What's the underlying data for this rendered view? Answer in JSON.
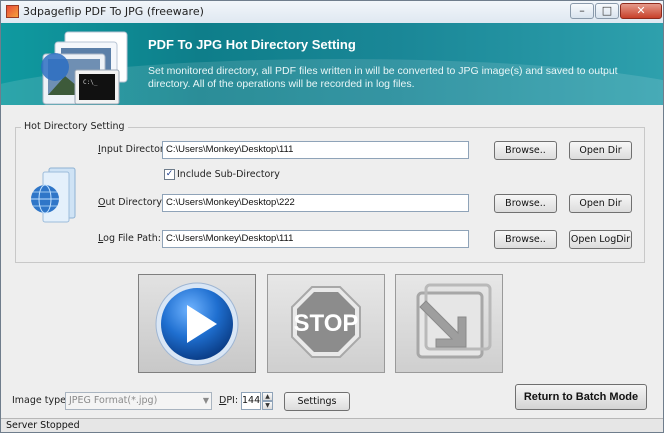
{
  "window": {
    "title": "3dpageflip PDF To JPG (freeware)",
    "minimize_glyph": "–",
    "maximize_glyph": "□",
    "close_glyph": "✕"
  },
  "banner": {
    "title": "PDF To JPG Hot Directory Setting",
    "description": "Set monitored directory, all PDF files written in will be converted to JPG image(s) and saved to output directory. All of the operations will be recorded in log files."
  },
  "settings": {
    "group_title": "Hot Directory Setting",
    "input_dir": {
      "label_key": "I",
      "label_rest": "nput Directory:",
      "value": "C:\\Users\\Monkey\\Desktop\\111",
      "browse": "Browse..",
      "open": "Open Dir"
    },
    "include_sub": {
      "checked_glyph": "✓",
      "label": "Include Sub-Directory",
      "checked": true
    },
    "out_dir": {
      "label_key": "O",
      "label_rest": "ut Directory:",
      "value": "C:\\Users\\Monkey\\Desktop\\222",
      "browse": "Browse..",
      "open": "Open Dir"
    },
    "log_path": {
      "label_key": "L",
      "label_rest": "og File Path:",
      "value": "C:\\Users\\Monkey\\Desktop\\111",
      "browse": "Browse..",
      "open": "Open LogDir"
    }
  },
  "actions": {
    "stop_label": "STOP"
  },
  "bottom": {
    "image_type_label": "Image type:",
    "image_type_value": "JPEG Format(*.jpg)",
    "dropdown_glyph": "▼",
    "dpi_key": "D",
    "dpi_rest": "PI:",
    "dpi_value": "144",
    "dpi_up_glyph": "▲",
    "dpi_down_glyph": "▼",
    "settings_button": "Settings",
    "return_button": "Return to Batch Mode"
  },
  "status": {
    "text": "Server Stopped"
  },
  "colors": {
    "banner": "#0e7e8a",
    "play": "#1565c0",
    "stop_sign": "#8a8a8a"
  }
}
